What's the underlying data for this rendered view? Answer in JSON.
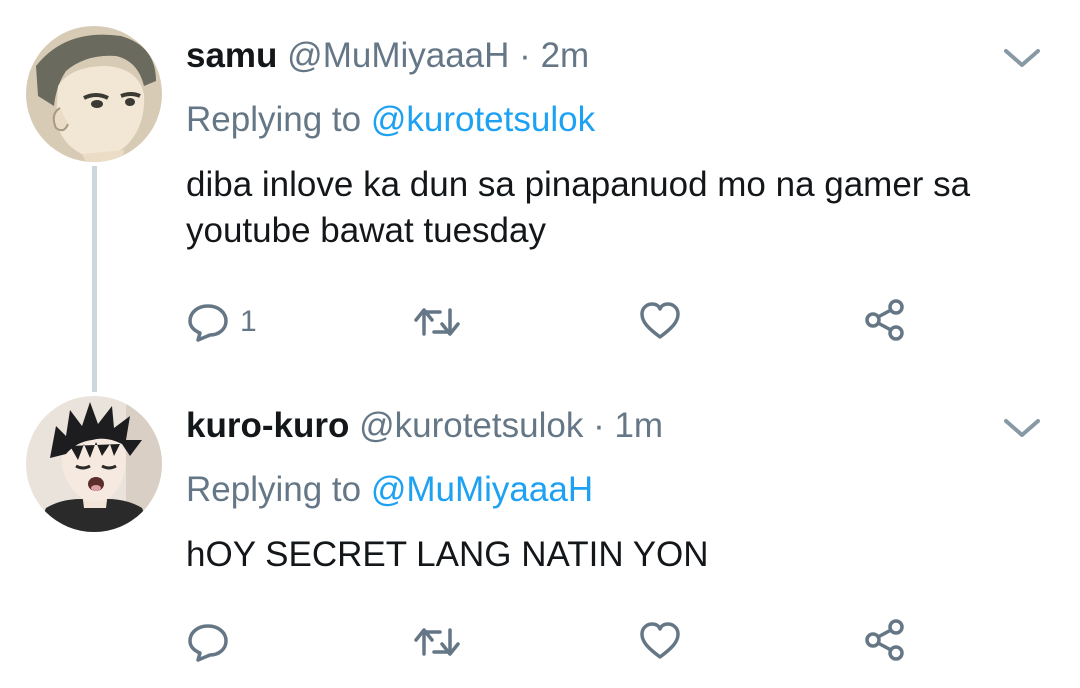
{
  "tweets": [
    {
      "name": "samu",
      "handle": "@MuMiyaaaH",
      "separator": "·",
      "time": "2m",
      "replying_prefix": "Replying to",
      "replying_to": "@kurotetsulok",
      "text": "diba inlove ka dun sa pinapanuod mo na gamer sa youtube bawat tuesday",
      "reply_count": "1",
      "avatar_icon": "avatar-samu"
    },
    {
      "name": "kuro-kuro",
      "handle": "@kurotetsulok",
      "separator": "·",
      "time": "1m",
      "replying_prefix": "Replying to",
      "replying_to": "@MuMiyaaaH",
      "text": "hOY SECRET LANG NATIN YON",
      "reply_count": "",
      "avatar_icon": "avatar-kuro"
    }
  ],
  "icons": [
    "chevron-down-icon",
    "reply-icon",
    "retweet-icon",
    "like-icon",
    "share-icon"
  ],
  "colors": {
    "text": "#14171a",
    "secondary": "#657786",
    "link": "#1da1f2",
    "thread_line": "#ccd6dd"
  }
}
